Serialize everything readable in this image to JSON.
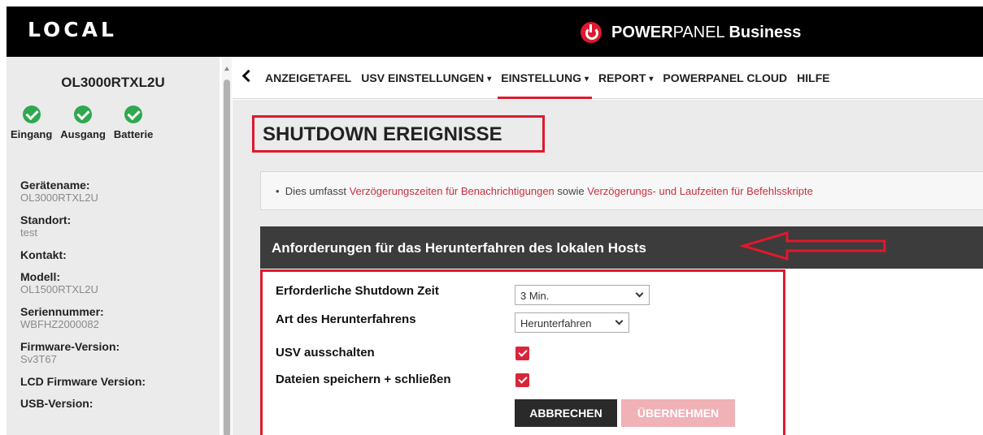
{
  "header": {
    "local_label": "LOCAL",
    "brand_bold": "POWER",
    "brand_thin": "PANEL",
    "brand_business": "Business",
    "brand_color": "#e0182d"
  },
  "sidebar": {
    "device_name": "OL3000RTXL2U",
    "status": [
      {
        "label": "Eingang",
        "icon": "check-circle-icon",
        "color": "#2fa84f"
      },
      {
        "label": "Ausgang",
        "icon": "check-circle-icon",
        "color": "#2fa84f"
      },
      {
        "label": "Batterie",
        "icon": "check-circle-icon",
        "color": "#2fa84f"
      }
    ],
    "info": [
      {
        "label": "Gerätename:",
        "value": "OL3000RTXL2U"
      },
      {
        "label": "Standort:",
        "value": "test"
      },
      {
        "label": "Kontakt:",
        "value": ""
      },
      {
        "label": "Modell:",
        "value": "OL1500RTXL2U"
      },
      {
        "label": "Seriennummer:",
        "value": "WBFHZ2000082"
      },
      {
        "label": "Firmware-Version:",
        "value": "Sv3T67"
      },
      {
        "label": "LCD Firmware Version:",
        "value": ""
      },
      {
        "label": "USB-Version:",
        "value": ""
      }
    ]
  },
  "nav": {
    "back_icon": "chevron-left-icon",
    "items": [
      {
        "label": "ANZEIGETAFEL",
        "dropdown": false
      },
      {
        "label": "USV EINSTELLUNGEN",
        "dropdown": true
      },
      {
        "label": "EINSTELLUNG",
        "dropdown": true,
        "active": true
      },
      {
        "label": "REPORT",
        "dropdown": true
      },
      {
        "label": "POWERPANEL CLOUD",
        "dropdown": false
      },
      {
        "label": "HILFE",
        "dropdown": false
      }
    ],
    "caret": "▾"
  },
  "main": {
    "title": "SHUTDOWN EREIGNISSE",
    "notice": {
      "bullet": "•",
      "text1": "Dies umfasst",
      "link1": "Verzögerungszeiten für Benachrichtigungen",
      "text2": "sowie",
      "link2": "Verzögerungs- und Laufzeiten für Befehlsskripte"
    },
    "section_title": "Anforderungen für das Herunterfahren des lokalen Hosts",
    "form": {
      "shutdown_time_label": "Erforderliche Shutdown Zeit",
      "shutdown_time_value": "3 Min.",
      "shutdown_type_label": "Art des Herunterfahrens",
      "shutdown_type_value": "Herunterfahren",
      "ups_off_label": "USV ausschalten",
      "ups_off_checked": true,
      "save_close_label": "Dateien speichern + schließen",
      "save_close_checked": true,
      "cancel_label": "ABBRECHEN",
      "apply_label": "ÜBERNEHMEN"
    }
  }
}
